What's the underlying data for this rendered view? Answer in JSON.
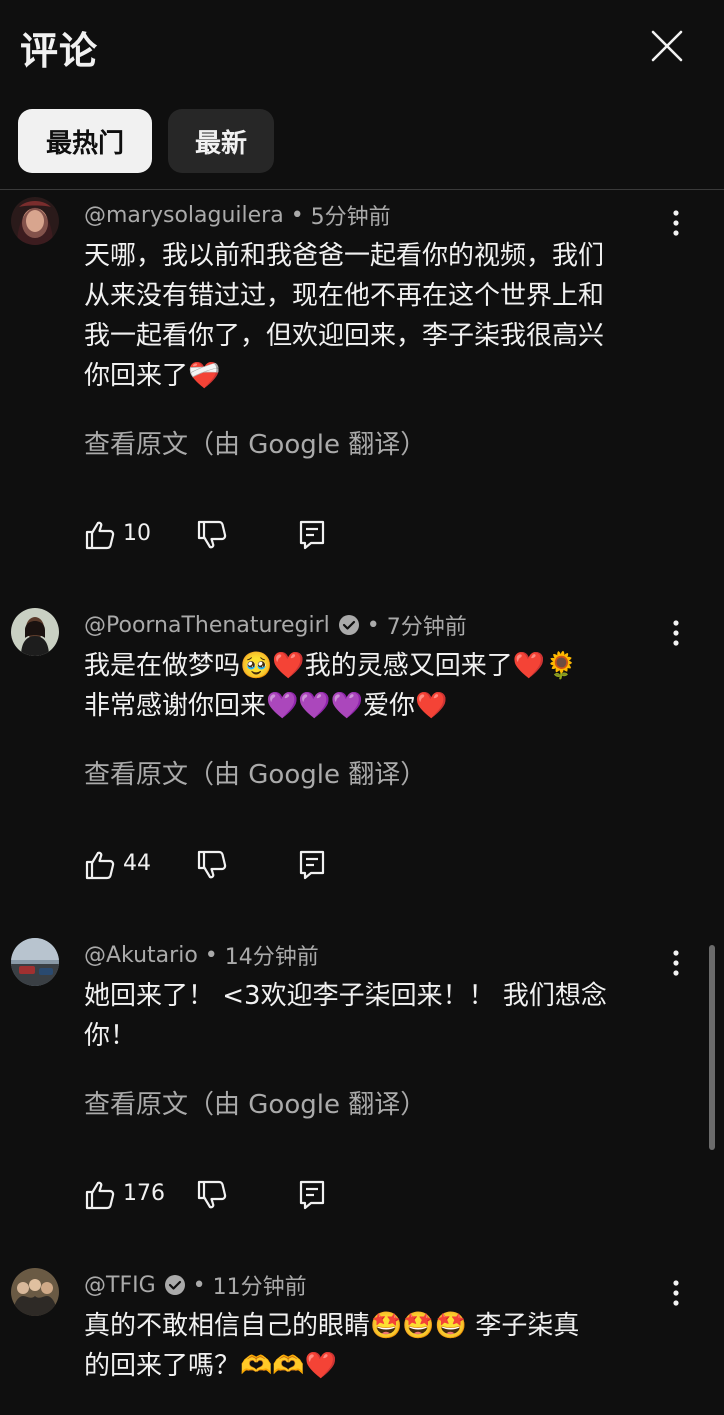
{
  "header": {
    "title": "评论",
    "close_icon": "close-icon"
  },
  "chips": {
    "top": "最热门",
    "newest": "最新"
  },
  "colors": {
    "background": "#0f0f0f",
    "text_primary": "#f1f1f1",
    "text_secondary": "#aaaaaa",
    "chip_active_bg": "#f1f1f1",
    "chip_inactive_bg": "#272727",
    "heart_red": "#e8212e",
    "heart_purple": "#8e44d8"
  },
  "comments": [
    {
      "author": "@marysolaguilera",
      "verified": false,
      "separator": "•",
      "time": "5分钟前",
      "lines": [
        "天哪，我以前和我爸爸一起看你的视频，我们",
        "从来没有错过过，现在他不再在这个世界上和",
        "我一起看你了，但欢迎回来，李子柒我很高兴",
        "你回来了❤️‍🩹"
      ],
      "translate": "查看原文（由 Google 翻译）",
      "likes": "10"
    },
    {
      "author": "@PoornaThenaturegirl",
      "verified": true,
      "separator": "•",
      "time": "7分钟前",
      "lines": [
        "我是在做梦吗🥹❤️我的灵感又回来了❤️🌻",
        "非常感谢你回来💜💜💜爱你❤️"
      ],
      "translate": "查看原文（由 Google 翻译）",
      "likes": "44"
    },
    {
      "author": "@Akutario",
      "verified": false,
      "separator": "•",
      "time": "14分钟前",
      "lines": [
        "她回来了！ <3欢迎李子柒回来！！ 我们想念",
        "你！"
      ],
      "translate": "查看原文（由 Google 翻译）",
      "likes": "176"
    },
    {
      "author": "@TFIG",
      "verified": true,
      "separator": "•",
      "time": "11分钟前",
      "lines": [
        "真的不敢相信自己的眼睛🤩🤩🤩 李子柒真",
        "的回来了嗎？🫶🫶❤️"
      ]
    }
  ]
}
